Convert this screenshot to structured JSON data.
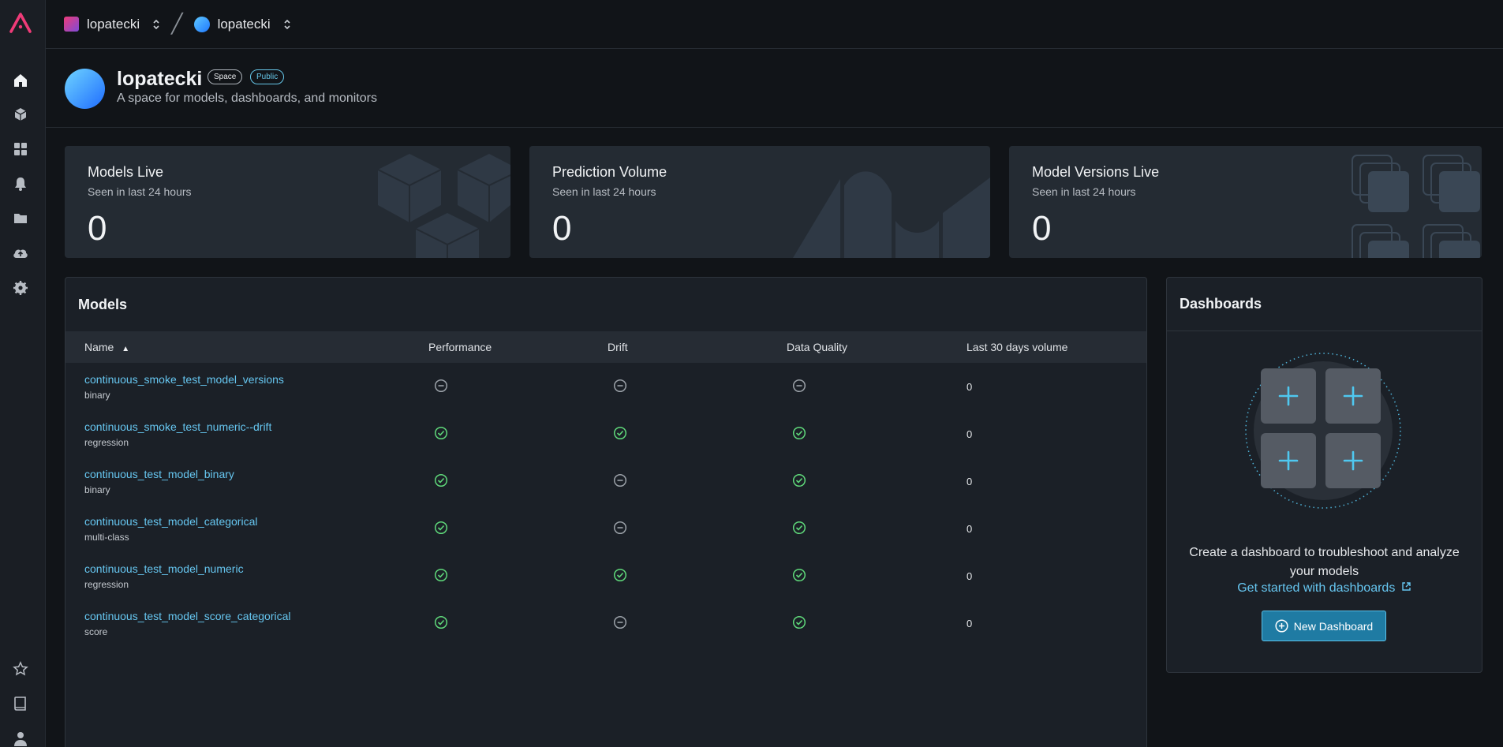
{
  "topbar": {
    "org_name": "lopatecki",
    "space_name": "lopatecki"
  },
  "header": {
    "title": "lopatecki",
    "badge_space": "Space",
    "badge_public": "Public",
    "description": "A space for models, dashboards, and monitors"
  },
  "stats": [
    {
      "title": "Models Live",
      "subtitle": "Seen in last 24 hours",
      "value": "0"
    },
    {
      "title": "Prediction Volume",
      "subtitle": "Seen in last 24 hours",
      "value": "0"
    },
    {
      "title": "Model Versions Live",
      "subtitle": "Seen in last 24 hours",
      "value": "0"
    }
  ],
  "models": {
    "title": "Models",
    "columns": {
      "name": "Name",
      "performance": "Performance",
      "drift": "Drift",
      "data_quality": "Data Quality",
      "volume": "Last 30 days volume"
    },
    "sort_column": "name",
    "sort_direction": "ascending",
    "rows": [
      {
        "name": "continuous_smoke_test_model_versions",
        "type": "binary",
        "performance": "neutral",
        "drift": "neutral",
        "data_quality": "neutral",
        "volume": "0"
      },
      {
        "name": "continuous_smoke_test_numeric--drift",
        "type": "regression",
        "performance": "ok",
        "drift": "ok",
        "data_quality": "ok",
        "volume": "0"
      },
      {
        "name": "continuous_test_model_binary",
        "type": "binary",
        "performance": "ok",
        "drift": "neutral",
        "data_quality": "ok",
        "volume": "0"
      },
      {
        "name": "continuous_test_model_categorical",
        "type": "multi-class",
        "performance": "ok",
        "drift": "neutral",
        "data_quality": "ok",
        "volume": "0"
      },
      {
        "name": "continuous_test_model_numeric",
        "type": "regression",
        "performance": "ok",
        "drift": "ok",
        "data_quality": "ok",
        "volume": "0"
      },
      {
        "name": "continuous_test_model_score_categorical",
        "type": "score",
        "performance": "ok",
        "drift": "neutral",
        "data_quality": "ok",
        "volume": "0"
      }
    ]
  },
  "dashboards": {
    "title": "Dashboards",
    "empty_text": "Create a dashboard to troubleshoot and analyze your models",
    "link_text": "Get started with dashboards",
    "button_label": "New Dashboard"
  },
  "colors": {
    "accent": "#66c6f0",
    "ok": "#5fd87a",
    "neutral": "#9aa0a7",
    "brand": "#ef3b78"
  },
  "icons": {
    "rail": [
      "arize-logo-icon",
      "home-icon",
      "cube-icon",
      "grid-icon",
      "bell-icon",
      "folder-icon",
      "cloud-upload-icon",
      "gear-icon",
      "star-icon",
      "book-icon",
      "user-icon"
    ],
    "status_ok": "check-circle-icon",
    "status_neutral": "minus-circle-icon"
  }
}
